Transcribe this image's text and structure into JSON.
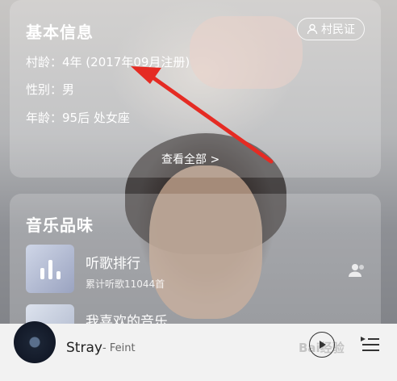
{
  "basic_info": {
    "title": "基本信息",
    "badge": "村民证",
    "village_age": "村龄：4年 (2017年09月注册)",
    "gender": "性别：男",
    "age": "年龄：95后 处女座",
    "view_all": "查看全部 >"
  },
  "music_taste": {
    "title": "音乐品味",
    "playlists": [
      {
        "name": "听歌排行",
        "sub": "累计听歌11044首"
      },
      {
        "name": "我喜欢的音乐"
      }
    ]
  },
  "player": {
    "song": "Stray",
    "artist": "- Feint"
  },
  "watermark": "Bai经验",
  "colors": {
    "arrow": "#e52b23",
    "player_bg": "#f2f2f2"
  }
}
